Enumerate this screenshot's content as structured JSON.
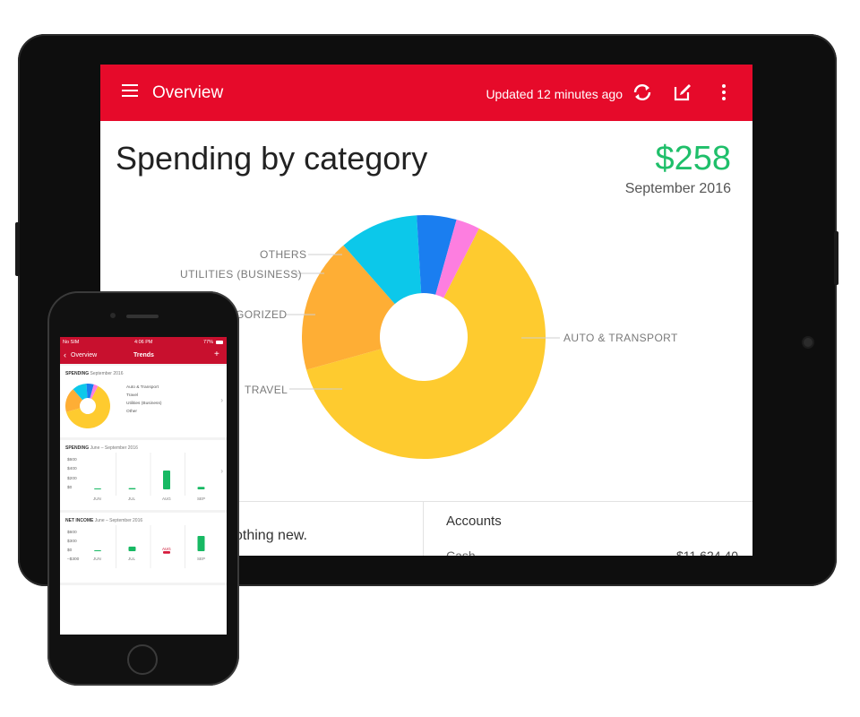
{
  "tablet": {
    "appbar": {
      "title": "Overview",
      "updated": "Updated 12 minutes ago",
      "icons": [
        "menu-icon",
        "refresh-icon",
        "edit-icon",
        "more-vert-icon"
      ],
      "color": "#e60a2a"
    },
    "headline": "Spending by category",
    "amount": "$258",
    "period": "September 2016",
    "chart_labels": {
      "others": "OTHERS",
      "utilities": "UTILITIES (BUSINESS)",
      "uncategorized": "GORIZED",
      "travel": "TRAVEL",
      "auto": "AUTO & TRANSPORT"
    },
    "bottom": {
      "nothing": "othing new.",
      "accounts_title": "Accounts",
      "cash_label": "Cash",
      "cash_value": "$11,624.40"
    }
  },
  "chart_data": {
    "type": "pie",
    "title": "Spending by category",
    "categories": [
      "Auto & Transport",
      "Travel",
      "Uncategorized",
      "Utilities (Business)",
      "Others"
    ],
    "values": [
      60,
      17,
      10,
      5,
      3
    ],
    "colors": [
      "#fecb2f",
      "#feae35",
      "#0cc8ea",
      "#1a7ef0",
      "#fd7ee0"
    ]
  },
  "phone": {
    "status": {
      "carrier": "No SIM",
      "time": "4:06 PM",
      "battery": "77%"
    },
    "nav": {
      "back": "Overview",
      "title": "Trends",
      "add": "+"
    },
    "spending_card": {
      "title_bold": "SPENDING",
      "title_rest": "September 2016",
      "legend": [
        "Auto & Transport",
        "Travel",
        "Utilities (Business)",
        "Other"
      ]
    },
    "spending_trend": {
      "title_bold": "SPENDING",
      "title_rest": "June – September 2016",
      "yticks": [
        "$600",
        "$400",
        "$200",
        "$0"
      ],
      "months": [
        "JUN",
        "JUL",
        "AUG",
        "SEP"
      ],
      "values": [
        5,
        20,
        300,
        40
      ]
    },
    "net_income": {
      "title_bold": "NET INCOME",
      "title_rest": "June – September 2016",
      "yticks": [
        "$600",
        "$300",
        "$0",
        "–$300"
      ],
      "months": [
        "JUN",
        "JUL",
        "AUG",
        "SEP"
      ],
      "values": [
        0,
        150,
        -80,
        500
      ]
    }
  }
}
